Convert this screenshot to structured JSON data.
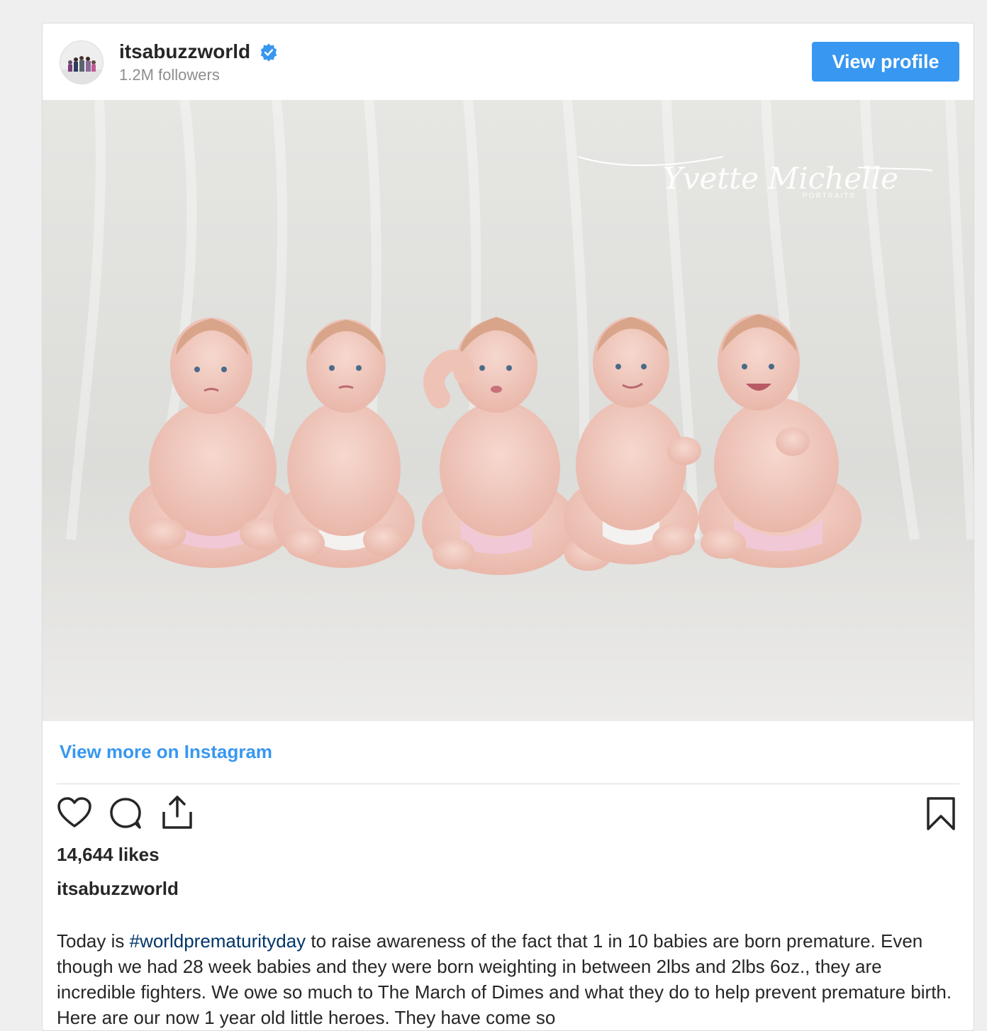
{
  "header": {
    "username": "itsabuzzworld",
    "followers": "1.2M followers",
    "view_profile_label": "View profile"
  },
  "photo": {
    "watermark_main": "Yvette Michelle",
    "watermark_sub": "PORTRAITS"
  },
  "view_more_label": "View more on Instagram",
  "actions": {
    "like_icon": "heart-icon",
    "comment_icon": "comment-icon",
    "share_icon": "share-icon",
    "save_icon": "bookmark-icon"
  },
  "likes": "14,644 likes",
  "caption": {
    "username": "itsabuzzworld",
    "prefix": "Today is ",
    "hashtag": "#worldprematurityday",
    "text": " to raise awareness of the fact that 1 in 10 babies are born premature. Even though we had 28 week babies and they were born weighting in between 2lbs and 2lbs 6oz., they are incredible fighters. We owe so much to The March of Dimes and what they do to help prevent premature birth. Here are our now 1 year old little heroes. They have come so"
  },
  "colors": {
    "accent": "#3897f0",
    "hashtag": "#003569",
    "text": "#262626",
    "muted": "#8e8e8e"
  }
}
